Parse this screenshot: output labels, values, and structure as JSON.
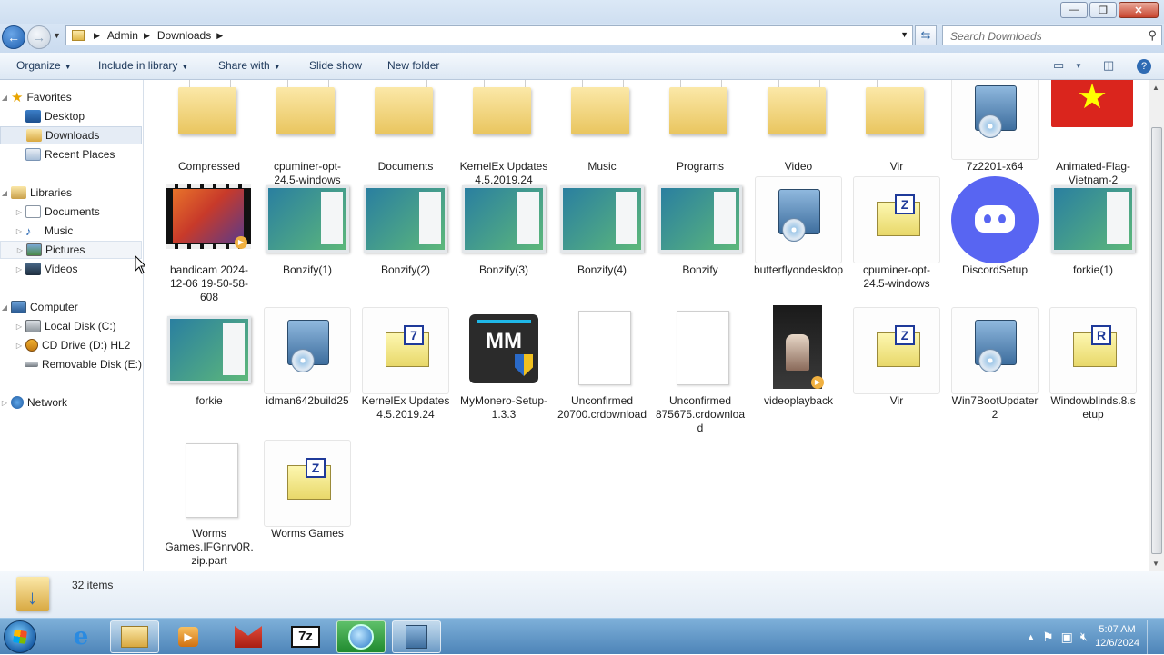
{
  "window": {
    "controls": {
      "minimize": "—",
      "maximize": "❐",
      "close": "✕"
    }
  },
  "address": {
    "back_glyph": "←",
    "forward_glyph": "→",
    "breadcrumbs": [
      "Admin",
      "Downloads"
    ],
    "search_placeholder": "Search Downloads"
  },
  "toolbar": {
    "organize": "Organize",
    "include_in_library": "Include in library",
    "share_with": "Share with",
    "slide_show": "Slide show",
    "new_folder": "New folder"
  },
  "nav": {
    "favorites": "Favorites",
    "desktop": "Desktop",
    "downloads": "Downloads",
    "recent_places": "Recent Places",
    "libraries": "Libraries",
    "documents": "Documents",
    "music": "Music",
    "pictures": "Pictures",
    "videos": "Videos",
    "computer": "Computer",
    "local_disk": "Local Disk (C:)",
    "cd_drive": "CD Drive (D:) HL2",
    "removable_disk": "Removable Disk (E:)",
    "network": "Network"
  },
  "files": [
    {
      "name": "Compressed",
      "type": "folder"
    },
    {
      "name": "cpuminer-opt-24.5-windows",
      "type": "folder"
    },
    {
      "name": "Documents",
      "type": "folder"
    },
    {
      "name": "KernelEx Updates 4.5.2019.24",
      "type": "folder"
    },
    {
      "name": "Music",
      "type": "folder"
    },
    {
      "name": "Programs",
      "type": "folder"
    },
    {
      "name": "Video",
      "type": "folder"
    },
    {
      "name": "Vir",
      "type": "folder"
    },
    {
      "name": "7z2201-x64",
      "type": "installer"
    },
    {
      "name": "Animated-Flag-Vietnam-2",
      "type": "flag"
    },
    {
      "name": "bandicam 2024-12-06 19-50-58-608",
      "type": "video"
    },
    {
      "name": "Bonzify(1)",
      "type": "app"
    },
    {
      "name": "Bonzify(2)",
      "type": "app"
    },
    {
      "name": "Bonzify(3)",
      "type": "app"
    },
    {
      "name": "Bonzify(4)",
      "type": "app"
    },
    {
      "name": "Bonzify",
      "type": "app"
    },
    {
      "name": "butterflyondesktop",
      "type": "installer"
    },
    {
      "name": "cpuminer-opt-24.5-windows",
      "type": "zip",
      "letter": "Z"
    },
    {
      "name": "DiscordSetup",
      "type": "discord"
    },
    {
      "name": "forkie(1)",
      "type": "app"
    },
    {
      "name": "forkie",
      "type": "app"
    },
    {
      "name": "idman642build25",
      "type": "installer"
    },
    {
      "name": "KernelEx Updates 4.5.2019.24",
      "type": "zip",
      "letter": "7"
    },
    {
      "name": "MyMonero-Setup-1.3.3",
      "type": "monero",
      "glyph": "MM"
    },
    {
      "name": "Unconfirmed 20700.crdownload",
      "type": "blank"
    },
    {
      "name": "Unconfirmed 875675.crdownload",
      "type": "blank"
    },
    {
      "name": "videoplayback",
      "type": "video2"
    },
    {
      "name": "Vir",
      "type": "zip",
      "letter": "Z"
    },
    {
      "name": "Win7BootUpdater2",
      "type": "installer"
    },
    {
      "name": "Windowblinds.8.setup",
      "type": "zip",
      "letter": "R"
    },
    {
      "name": "Worms Games.IFGnrv0R.zip.part",
      "type": "blank"
    },
    {
      "name": "Worms Games",
      "type": "zip",
      "letter": "Z"
    }
  ],
  "status": {
    "item_count": "32 items"
  },
  "taskbar": {
    "time": "5:07 AM",
    "date": "12/6/2024",
    "sevenzip_label": "7z"
  },
  "colors": {
    "accent": "#4d84b8",
    "discord": "#5865f2",
    "flag_red": "#da251d",
    "flag_star": "#ffff00"
  }
}
